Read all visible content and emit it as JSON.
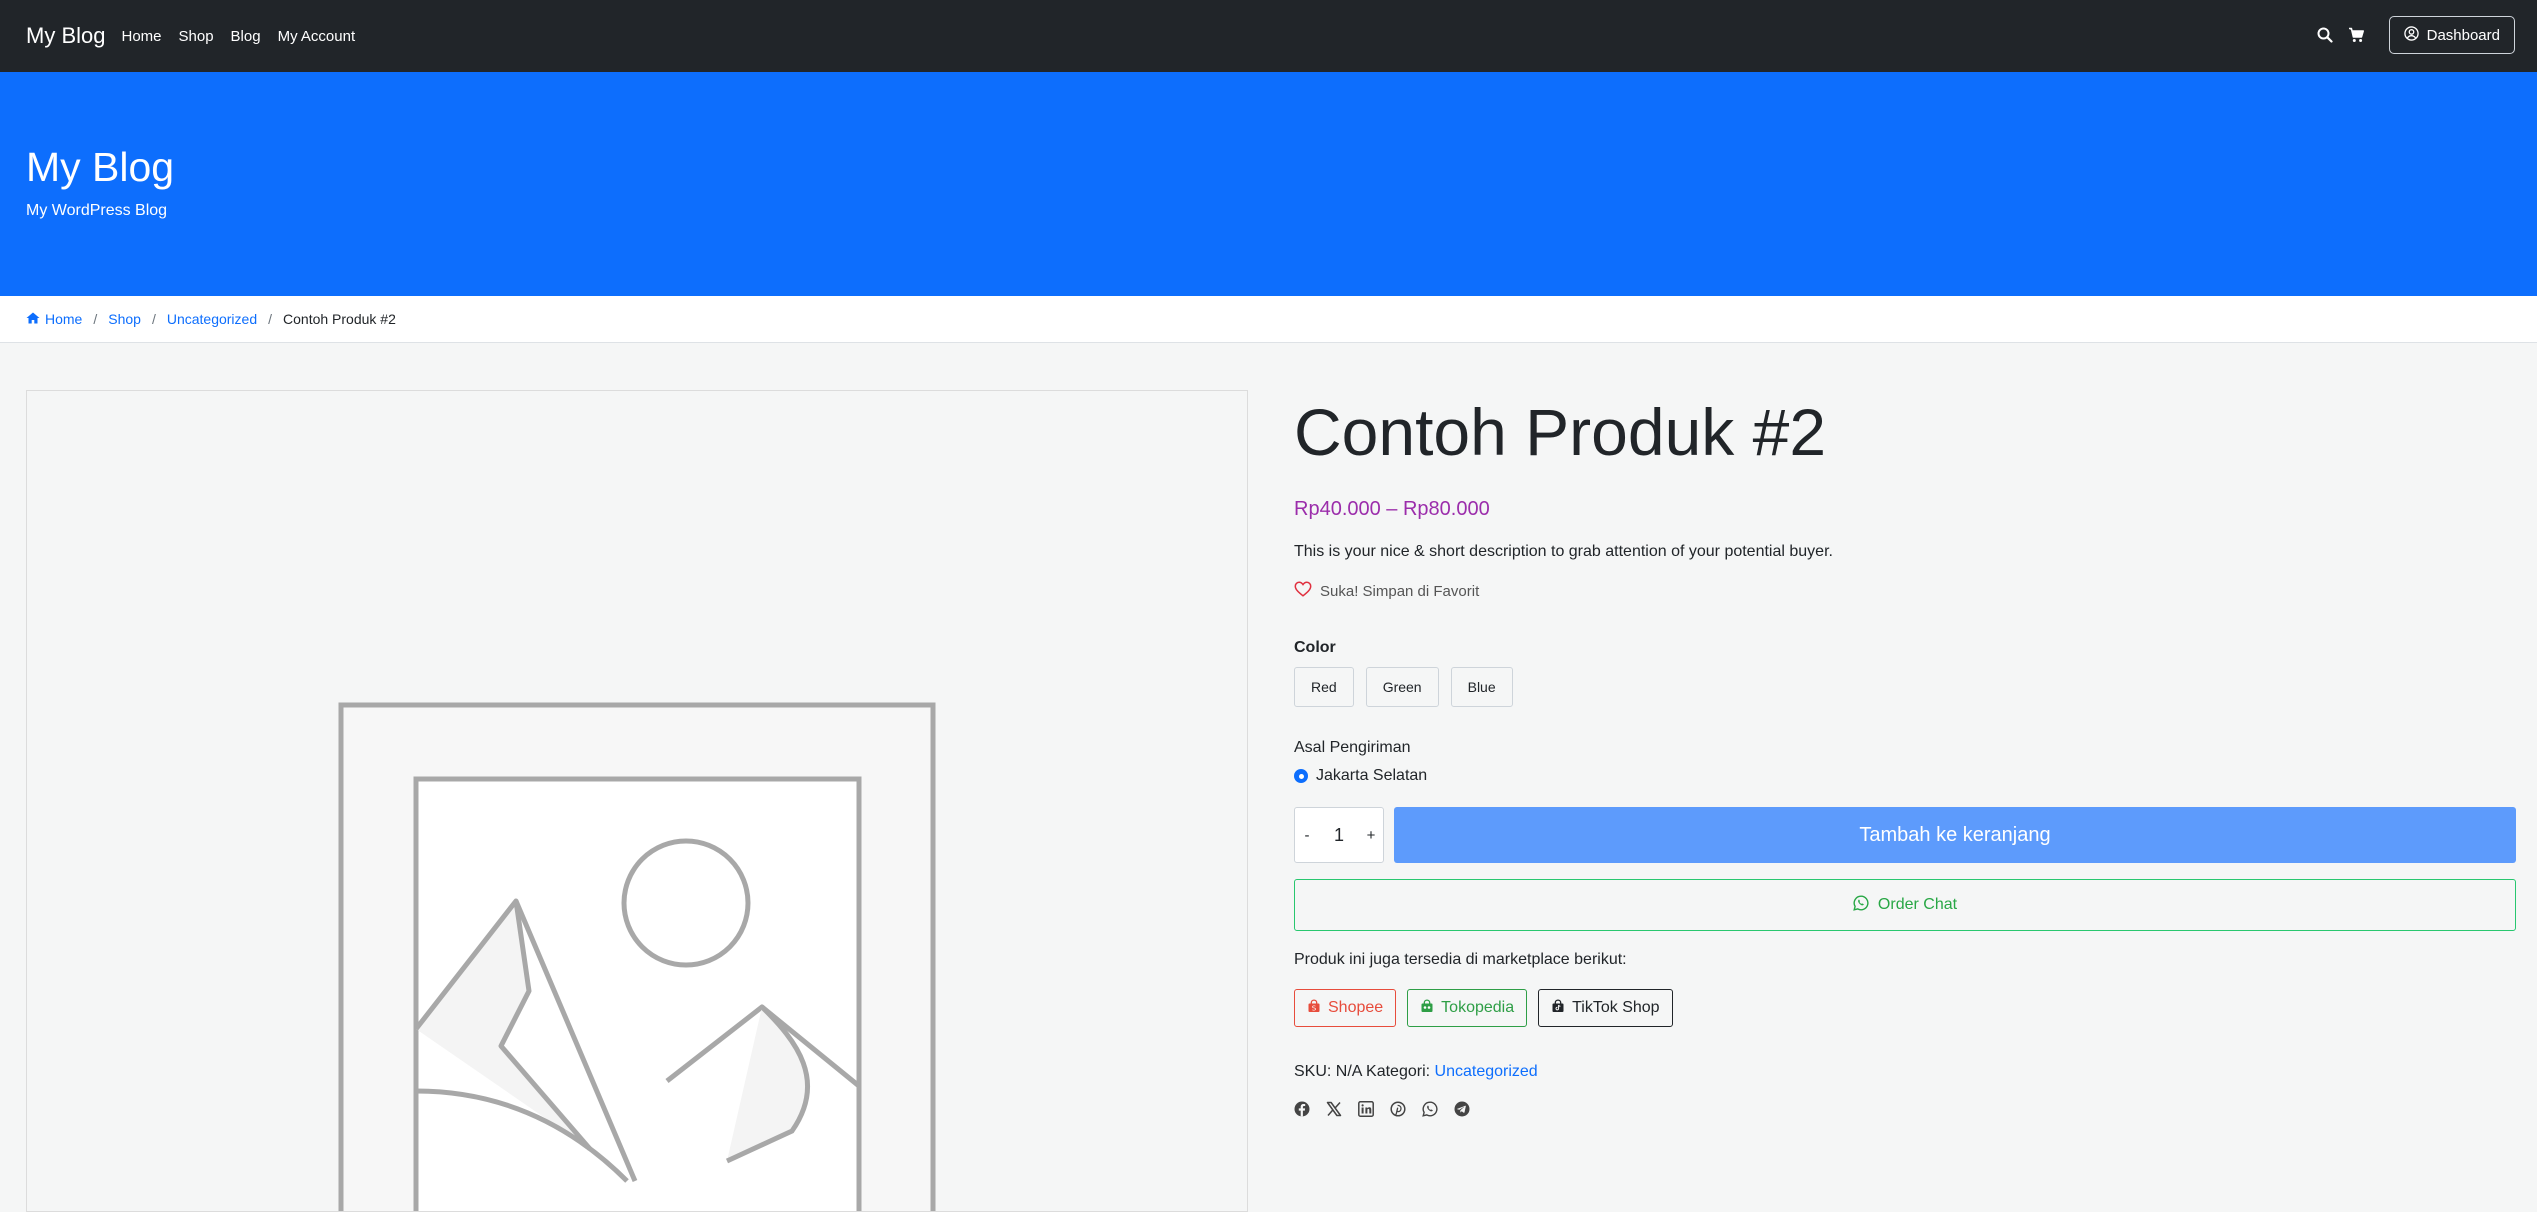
{
  "nav": {
    "brand": "My Blog",
    "links": [
      "Home",
      "Shop",
      "Blog",
      "My Account"
    ],
    "dashboard_label": "Dashboard"
  },
  "hero": {
    "title": "My Blog",
    "tagline": "My WordPress Blog"
  },
  "breadcrumb": {
    "items": [
      "Home",
      "Shop",
      "Uncategorized"
    ],
    "current": "Contoh Produk #2"
  },
  "product": {
    "title": "Contoh Produk #2",
    "price": "Rp40.000 – Rp80.000",
    "short_description": "This is your nice & short description to grab attention of your potential buyer.",
    "favorite_label": "Suka! Simpan di Favorit",
    "attribute_label": "Color",
    "colors": [
      "Red",
      "Green",
      "Blue"
    ],
    "shipping_label": "Asal Pengiriman",
    "shipping_option": "Jakarta Selatan",
    "qty_minus": "-",
    "qty_plus": "+",
    "quantity": "1",
    "add_to_cart_label": "Tambah ke keranjang",
    "order_chat_label": "Order Chat",
    "marketplace_label": "Produk ini juga tersedia di marketplace berikut:",
    "marketplaces": [
      "Shopee",
      "Tokopedia",
      "TikTok Shop"
    ],
    "sku_text": "SKU: N/A Kategori: ",
    "category": "Uncategorized"
  },
  "colors": {
    "navbar": "#212529",
    "hero": "#0d6efd",
    "price": "#9b2dab",
    "add_to_cart": "#5d9bfc",
    "whatsapp": "#28a745",
    "shopee": "#e74c3c",
    "tokopedia": "#2e9e46"
  },
  "icons": {
    "nav": [
      "search-icon",
      "cart-icon",
      "user-circle-icon"
    ],
    "share": [
      "facebook-icon",
      "x-icon",
      "linkedin-icon",
      "pinterest-icon",
      "whatsapp-icon",
      "telegram-icon"
    ]
  }
}
